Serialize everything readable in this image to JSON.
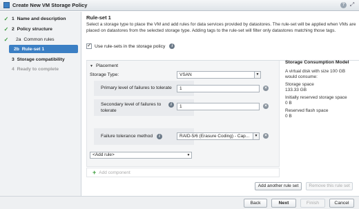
{
  "window": {
    "title": "Create New VM Storage Policy",
    "help_glyph": "?"
  },
  "steps": [
    {
      "num": "1",
      "label": "Name and description",
      "done": true
    },
    {
      "num": "2",
      "label": "Policy structure",
      "done": true
    },
    {
      "num": "2a",
      "label": "Common rules",
      "done": true
    },
    {
      "num": "2b",
      "label": "Rule-set 1",
      "active": true
    },
    {
      "num": "3",
      "label": "Storage compatibility"
    },
    {
      "num": "4",
      "label": "Ready to complete"
    }
  ],
  "main": {
    "title": "Rule-set 1",
    "description": "Select a storage type to place the VM and add rules for data services provided by datastores. The rule-set will be applied when VMs are placed on datastores from the selected storage type. Adding tags to the rule-set will filter only datastores matching those tags.",
    "use_rulesets_label": "Use rule-sets in the storage policy"
  },
  "placement": {
    "header": "Placement",
    "storage_type_label": "Storage Type:",
    "storage_type_value": "VSAN",
    "primary_label": "Primary level of failures to tolerate",
    "primary_value": "1",
    "secondary_label_1": "Secondary level of failures to",
    "secondary_label_2": "tolerate",
    "secondary_value": "1",
    "ftm_label": "Failure tolerance method",
    "ftm_value": "RAID-5/6 (Erasure Coding) - Cap...",
    "add_rule": "<Add rule>",
    "add_component": "Add component"
  },
  "consumption": {
    "title": "Storage Consumption Model",
    "line1": "A virtual disk with size 100 GB would consume:",
    "space_label": "Storage space",
    "space_value": "133.33 GB",
    "reserved_label": "Initially reserved storage space",
    "reserved_value": "0 B",
    "flash_label": "Reserved flash space",
    "flash_value": "0 B"
  },
  "ruleset_buttons": {
    "add": "Add another rule set",
    "remove": "Remove this rule set"
  },
  "footer": {
    "back": "Back",
    "next": "Next",
    "finish": "Finish",
    "cancel": "Cancel"
  }
}
